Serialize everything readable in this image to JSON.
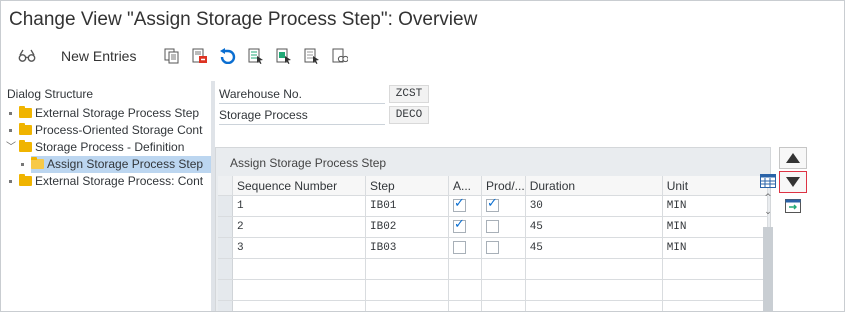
{
  "window": {
    "title": "Change View \"Assign Storage Process Step\": Overview"
  },
  "toolbar": {
    "new_entries_label": "New Entries",
    "icons": [
      "glasses-icon",
      "copy-icon",
      "delete-icon",
      "undo-icon",
      "select-all-icon",
      "select-block-icon",
      "deselect-all-icon",
      "details-icon"
    ]
  },
  "sidebar": {
    "header": "Dialog Structure",
    "items": [
      {
        "label": "External Storage Process Step",
        "level": 0,
        "expanded": false
      },
      {
        "label": "Process-Oriented Storage Cont",
        "level": 0,
        "expanded": false
      },
      {
        "label": "Storage Process - Definition",
        "level": 0,
        "expanded": true
      },
      {
        "label": "Assign Storage Process Step",
        "level": 1,
        "selected": true
      },
      {
        "label": "External Storage Process: Cont",
        "level": 0,
        "expanded": false
      }
    ]
  },
  "fields": {
    "warehouse_label": "Warehouse No.",
    "warehouse_value": "ZCST",
    "storage_process_label": "Storage Process",
    "storage_process_value": "DECO"
  },
  "grid": {
    "title": "Assign Storage Process Step",
    "columns": [
      "Sequence Number",
      "Step",
      "A...",
      "Prod/...",
      "Duration",
      "Unit"
    ],
    "rows": [
      {
        "seq": "1",
        "step": "IB01",
        "a": true,
        "prod": true,
        "duration": "30",
        "unit": "MIN"
      },
      {
        "seq": "2",
        "step": "IB02",
        "a": true,
        "prod": false,
        "duration": "45",
        "unit": "MIN"
      },
      {
        "seq": "3",
        "step": "IB03",
        "a": false,
        "prod": false,
        "duration": "45",
        "unit": "MIN"
      }
    ],
    "empty_rows": 3
  },
  "colors": {
    "folder": "#f0b400",
    "selected": "#bcd6f0",
    "checkmark": "#0a6ed1",
    "accent_red": "#d34"
  }
}
